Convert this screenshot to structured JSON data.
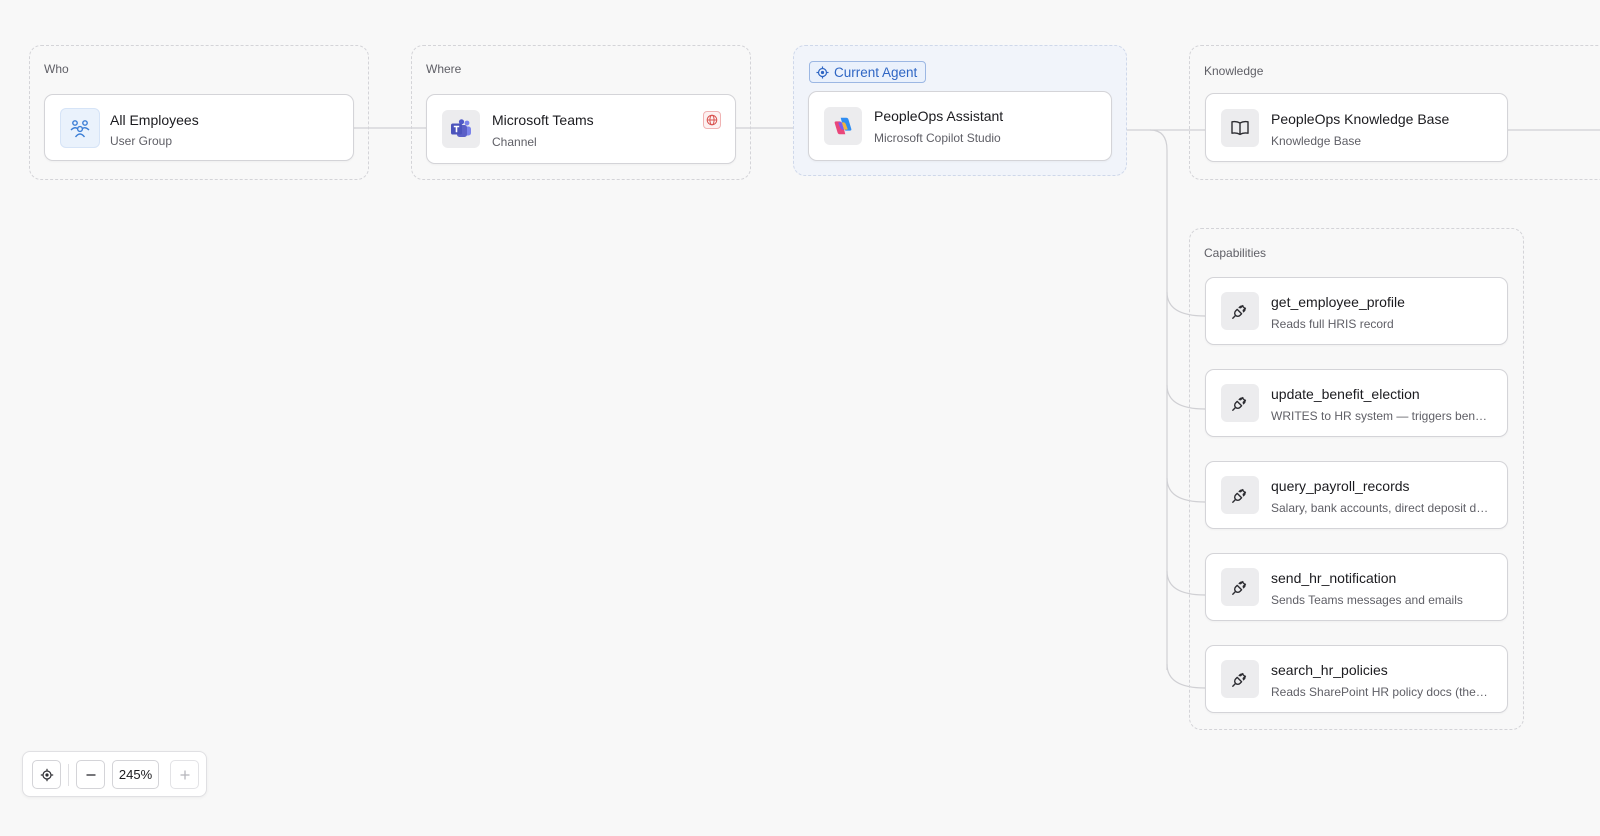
{
  "groups": {
    "who": {
      "label": "Who",
      "node": {
        "title": "All Employees",
        "subtitle": "User Group",
        "icon": "people-group-icon"
      }
    },
    "where": {
      "label": "Where",
      "node": {
        "title": "Microsoft Teams",
        "subtitle": "Channel",
        "icon": "microsoft-teams-icon",
        "badge_icon": "globe-icon"
      }
    },
    "agent": {
      "badge_label": "Current Agent",
      "node": {
        "title": "PeopleOps Assistant",
        "subtitle": "Microsoft Copilot Studio",
        "icon": "copilot-icon"
      }
    },
    "knowledge": {
      "label": "Knowledge",
      "node": {
        "title": "PeopleOps Knowledge Base",
        "subtitle": "Knowledge Base",
        "icon": "book-icon"
      }
    },
    "capabilities": {
      "label": "Capabilities",
      "items": [
        {
          "title": "get_employee_profile",
          "subtitle": "Reads full HRIS record",
          "icon": "plug-icon"
        },
        {
          "title": "update_benefit_election",
          "subtitle": "WRITES to HR system — triggers benef…",
          "icon": "plug-icon"
        },
        {
          "title": "query_payroll_records",
          "subtitle": "Salary, bank accounts, direct deposit d…",
          "icon": "plug-icon"
        },
        {
          "title": "send_hr_notification",
          "subtitle": "Sends Teams messages and emails",
          "icon": "plug-icon"
        },
        {
          "title": "search_hr_policies",
          "subtitle": "Reads SharePoint HR policy docs (the…",
          "icon": "plug-icon"
        }
      ]
    }
  },
  "zoom": {
    "value": "245%"
  },
  "colors": {
    "accent_blue": "#2f66c4",
    "teams_purple": "#5059c9",
    "globe_red": "#d9534f",
    "background": "#f8f8f8"
  }
}
